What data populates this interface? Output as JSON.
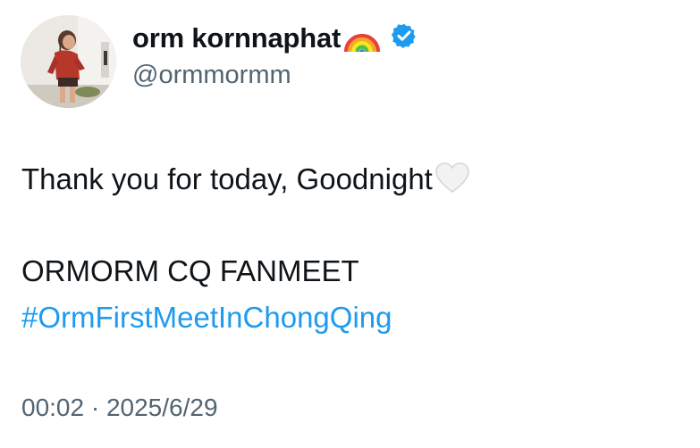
{
  "author": {
    "display_name": "orm kornnaphat",
    "name_emoji": "rainbow-emoji",
    "verified_icon": "verified-badge-icon",
    "handle": "@ormmormm",
    "avatar_icon": "avatar-photo"
  },
  "tweet": {
    "line1": "Thank you for today, Goodnight",
    "line1_emoji": "white-heart-emoji",
    "line2": "ORMORM CQ FANMEET",
    "hashtag": "#OrmFirstMeetInChongQing"
  },
  "meta": {
    "time": "00:02",
    "separator": " · ",
    "date": "2025/6/29"
  },
  "colors": {
    "text": "#0f1419",
    "secondary": "#536471",
    "link": "#1d9bf0",
    "verified": "#1d9bf0"
  }
}
